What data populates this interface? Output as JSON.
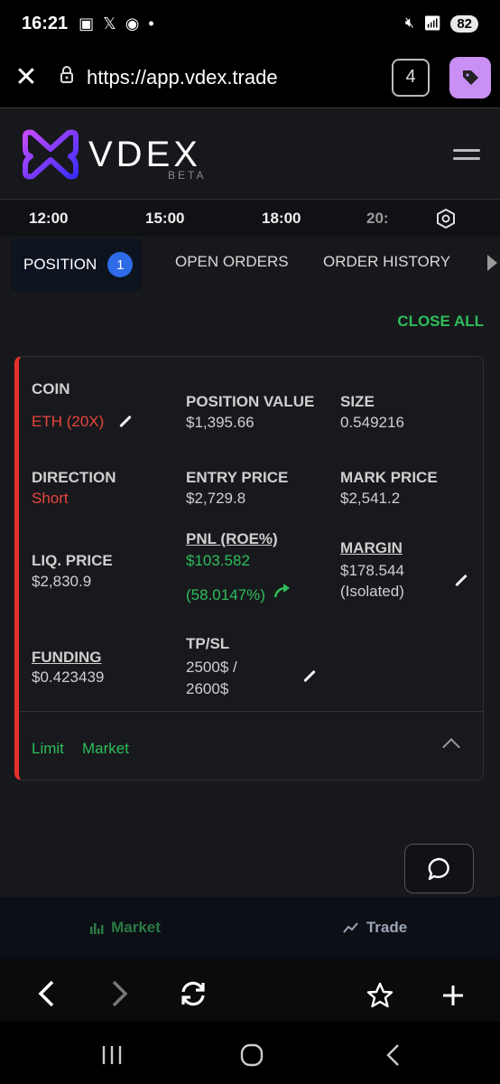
{
  "status_bar": {
    "time": "16:21",
    "battery": "82"
  },
  "browser": {
    "url": "https://app.vdex.trade",
    "tab_count": "4"
  },
  "app": {
    "logo_text": "VDEX",
    "beta": "BETA"
  },
  "time_axis": {
    "ticks": [
      "12:00",
      "15:00",
      "18:00",
      "20:"
    ]
  },
  "tabs": {
    "position": "POSITION",
    "position_count": "1",
    "open_orders": "OPEN ORDERS",
    "order_history": "ORDER HISTORY"
  },
  "close_all": "CLOSE ALL",
  "position": {
    "coin_label": "COIN",
    "coin_value": "ETH (20X)",
    "position_value_label": "POSITION VALUE",
    "position_value": "$1,395.66",
    "size_label": "SIZE",
    "size_value": "0.549216",
    "direction_label": "DIRECTION",
    "direction_value": "Short",
    "entry_price_label": "ENTRY PRICE",
    "entry_price": "$2,729.8",
    "mark_price_label": "MARK PRICE",
    "mark_price": "$2,541.2",
    "liq_price_label": "LIQ. PRICE",
    "liq_price": "$2,830.9",
    "pnl_label": "PNL (ROE%)",
    "pnl_value": "$103.582",
    "roe_value": "(58.0147%)",
    "margin_label": "MARGIN",
    "margin_value": "$178.544",
    "margin_mode": "(Isolated)",
    "funding_label": "FUNDING",
    "funding_value": "$0.423439",
    "tpsl_label": "TP/SL",
    "tpsl_line1": "2500$ /",
    "tpsl_line2": "2600$",
    "limit_label": "Limit",
    "market_label": "Market"
  },
  "bottom_nav": {
    "market": "Market",
    "trade": "Trade"
  },
  "colors": {
    "short": "#e8453c",
    "profit": "#2ebd5a",
    "badge": "#2f6be6",
    "extension": "#c98ff5"
  }
}
